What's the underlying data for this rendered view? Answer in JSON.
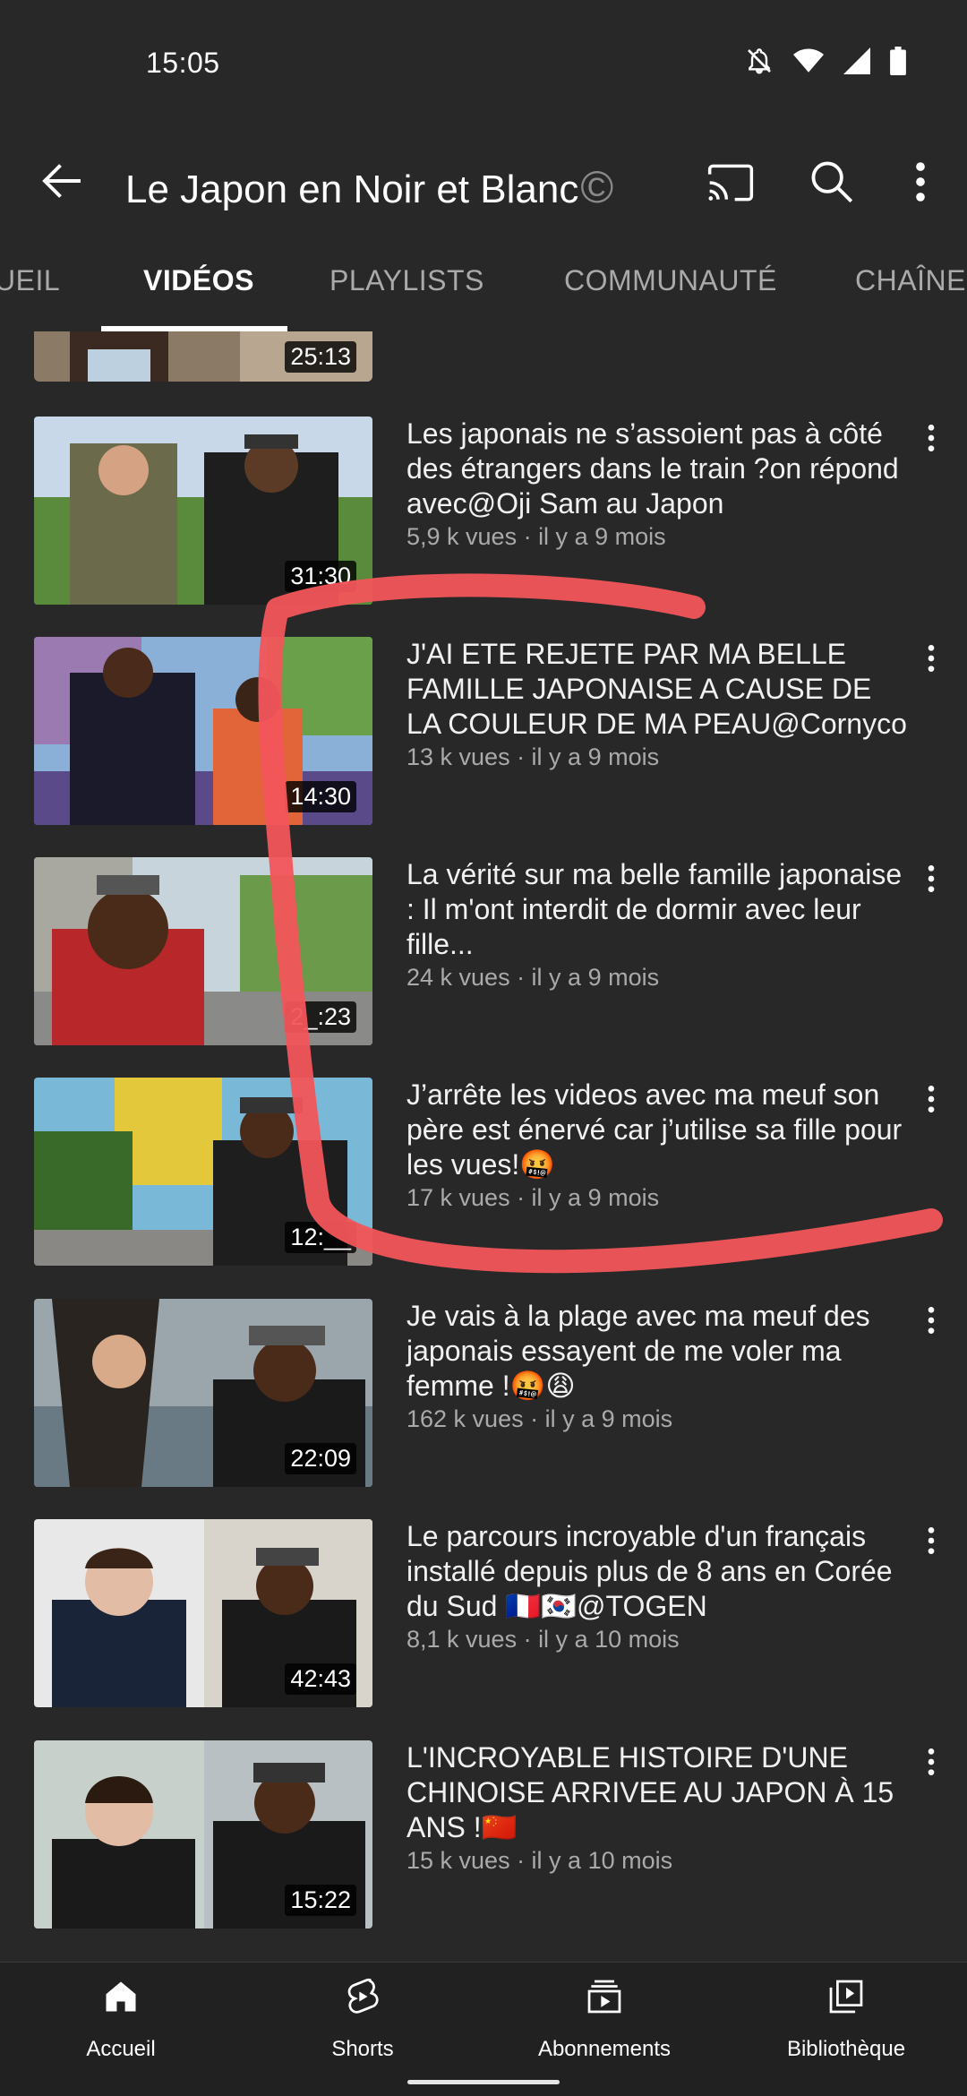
{
  "status_bar": {
    "time": "15:05"
  },
  "header": {
    "channel_title": "Le Japon en Noir et Blanc",
    "title_mark": "©"
  },
  "tabs": [
    {
      "label": "UEIL",
      "active": false
    },
    {
      "label": "VIDÉOS",
      "active": true
    },
    {
      "label": "PLAYLISTS",
      "active": false
    },
    {
      "label": "COMMUNAUTÉ",
      "active": false
    },
    {
      "label": "CHAÎNES",
      "active": false
    }
  ],
  "partial_video": {
    "duration": "25:13"
  },
  "videos": [
    {
      "title": "Les japonais ne s’assoient pas à côté des étrangers dans le train ?on répond avec@Oji Sam au Japon",
      "meta": "5,9 k vues · il y a 9 mois",
      "duration": "31:30"
    },
    {
      "title": "J'AI ETE REJETE PAR MA BELLE FAMILLE JAPONAISE A CAUSE DE LA COULEUR DE MA PEAU@Cornyco",
      "meta": "13 k vues · il y a 9 mois",
      "duration": "14:30"
    },
    {
      "title": "La vérité sur ma belle famille japonaise : Il m'ont interdit de dormir avec leur fille...",
      "meta": "24 k vues · il y a 9 mois",
      "duration": "2_:23"
    },
    {
      "title": "J’arrête les videos avec ma meuf son père est énervé car j’utilise sa fille pour les vues!🤬",
      "meta": "17 k vues · il y a 9 mois",
      "duration": "12:__"
    },
    {
      "title": "Je vais à la plage avec ma meuf des japonais essayent de me voler ma femme !🤬😩",
      "meta": "162 k vues · il y a 9 mois",
      "duration": "22:09"
    },
    {
      "title": "Le parcours incroyable d'un français installé depuis plus de 8 ans en Corée du Sud 🇫🇷🇰🇷@TOGEN",
      "meta": "8,1 k vues · il y a 10 mois",
      "duration": "42:43"
    },
    {
      "title": "L'INCROYABLE HISTOIRE D'UNE CHINOISE ARRIVEE AU JAPON À 15 ANS !🇨🇳",
      "meta": "15 k vues · il y a 10 mois",
      "duration": "15:22"
    }
  ],
  "bottom_nav": [
    {
      "label": "Accueil",
      "icon": "home-icon"
    },
    {
      "label": "Shorts",
      "icon": "shorts-icon"
    },
    {
      "label": "Abonnements",
      "icon": "subscriptions-icon"
    },
    {
      "label": "Bibliothèque",
      "icon": "library-icon"
    }
  ],
  "colors": {
    "background": "#282828",
    "nav_background": "#212121",
    "secondary_text": "#aaaaaa",
    "annotation": "#f2555a"
  }
}
